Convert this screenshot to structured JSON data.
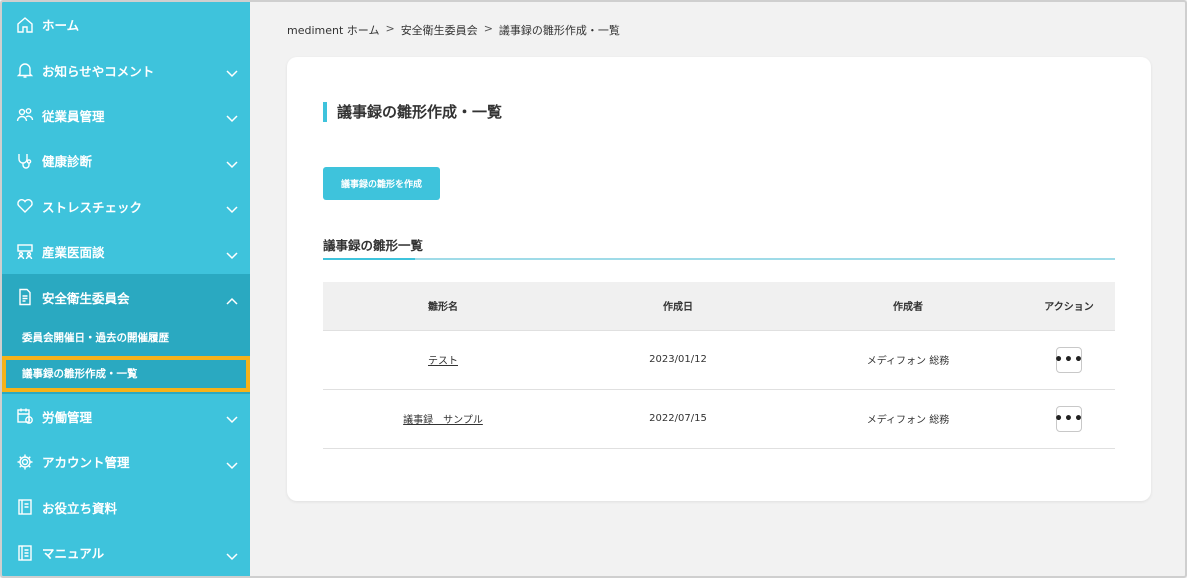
{
  "sidebar": {
    "items": [
      {
        "label": "ホーム",
        "icon": "home-icon",
        "chevron": false
      },
      {
        "label": "お知らせやコメント",
        "icon": "bell-icon",
        "chevron": true
      },
      {
        "label": "従業員管理",
        "icon": "users-icon",
        "chevron": true
      },
      {
        "label": "健康診断",
        "icon": "stethoscope-icon",
        "chevron": true
      },
      {
        "label": "ストレスチェック",
        "icon": "heart-icon",
        "chevron": true
      },
      {
        "label": "産業医面談",
        "icon": "meeting-icon",
        "chevron": true
      }
    ],
    "active_item": {
      "label": "安全衛生委員会",
      "icon": "document-icon"
    },
    "sub_items": [
      {
        "label": "委員会開催日・過去の開催履歴"
      },
      {
        "label": "議事録の雛形作成・一覧"
      }
    ],
    "items_after": [
      {
        "label": "労働管理",
        "icon": "calendar-clock-icon",
        "chevron": true
      },
      {
        "label": "アカウント管理",
        "icon": "gear-icon",
        "chevron": true
      },
      {
        "label": "お役立ち資料",
        "icon": "book-icon",
        "chevron": false
      },
      {
        "label": "マニュアル",
        "icon": "manual-icon",
        "chevron": true
      }
    ],
    "highlight_color": "#f5b21a",
    "bg_color": "#3ec3dc"
  },
  "breadcrumb": {
    "items": [
      "mediment ホーム",
      "安全衛生委員会",
      "議事録の雛形作成・一覧"
    ],
    "separator": ">"
  },
  "main": {
    "page_title": "議事録の雛形作成・一覧",
    "create_button": "議事録の雛形を作成",
    "section_title": "議事録の雛形一覧",
    "table": {
      "headers": [
        "雛形名",
        "作成日",
        "作成者",
        "アクション"
      ],
      "rows": [
        {
          "name": "テスト",
          "date": "2023/01/12",
          "author": "メディフォン 総務",
          "action": "•••"
        },
        {
          "name": "議事録　サンプル",
          "date": "2022/07/15",
          "author": "メディフォン 総務",
          "action": "•••"
        }
      ]
    }
  }
}
